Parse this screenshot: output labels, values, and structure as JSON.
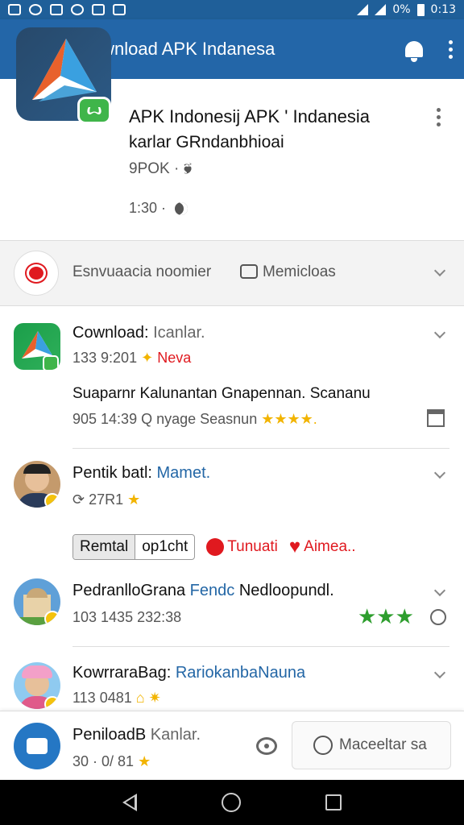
{
  "status_bar": {
    "battery": "0%",
    "time": "0:13"
  },
  "app_bar": {
    "title": "Download APK Indanesa"
  },
  "app_header": {
    "title_line1": "APK Indonesij APK ' Indanesia",
    "title_line2": "karlar GRndanbhioai",
    "meta1": "9POK · 🙘",
    "meta2": "1:30 ·",
    "badge": "ꙍ"
  },
  "filter_bar": {
    "text": "Esnvuaacia noomier",
    "chat_label": "Memicloas"
  },
  "list": {
    "item1": {
      "name": "Cownload:",
      "name_grey": "Icanlar.",
      "sub": "133 9:201",
      "tag": "Neva",
      "desc": "Suaparnr Kalunantan Gnapennan. Scananu",
      "desc2": "905 14:39",
      "desc2b": "Q nyage Seasnun",
      "stars": "★★★★."
    },
    "item2": {
      "name": "Pentik batl:",
      "name_accent": "Mamet.",
      "sub": "27R1",
      "star": "★"
    },
    "chips": {
      "chip1": "Remtal",
      "chip2": "op1cht",
      "red1": "Tunuati",
      "red2": "Aimea.."
    },
    "item3": {
      "name": "PedranlloGrana",
      "name_accent": "Fendc",
      "name_rest": "Nedloopundl.",
      "sub": "103 1435  232:38",
      "stars": "★★★"
    },
    "item4": {
      "name": "KowrraraBag:",
      "name_accent": "RariokanbaNauna",
      "sub": "113 0481"
    }
  },
  "bottom_bar": {
    "name": "PeniloadB",
    "name_grey": "Kanlar.",
    "sub": "30 · 0/ 81",
    "button": "Maceeltar sa"
  }
}
